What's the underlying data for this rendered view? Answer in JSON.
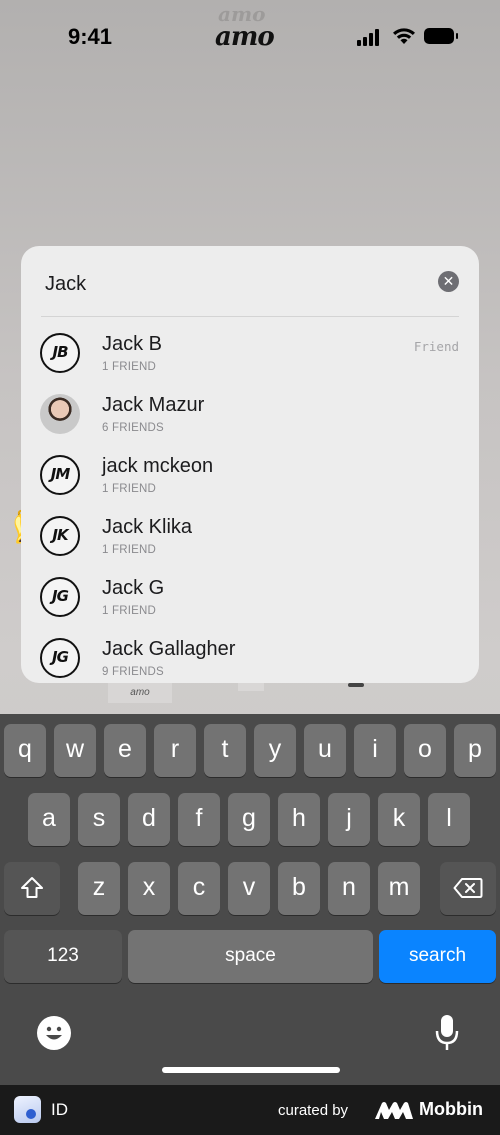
{
  "status_bar": {
    "time": "9:41",
    "logo": "amo"
  },
  "search": {
    "query": "Jack",
    "clear_icon": "clear-circle-icon"
  },
  "results": [
    {
      "initials": "JB",
      "name": "Jack B",
      "count": "1 FRIEND",
      "tag": "Friend",
      "avatar": "initials"
    },
    {
      "initials": "",
      "name": "Jack Mazur",
      "count": "6 FRIENDS",
      "tag": "",
      "avatar": "photo"
    },
    {
      "initials": "JM",
      "name": "jack mckeon",
      "count": "1 FRIEND",
      "tag": "",
      "avatar": "initials"
    },
    {
      "initials": "JK",
      "name": "Jack Klika",
      "count": "1 FRIEND",
      "tag": "",
      "avatar": "initials"
    },
    {
      "initials": "JG",
      "name": "Jack G",
      "count": "1 FRIEND",
      "tag": "",
      "avatar": "initials"
    },
    {
      "initials": "JG",
      "name": "Jack Gallagher",
      "count": "9 FRIENDS",
      "tag": "",
      "avatar": "initials"
    }
  ],
  "background": {
    "thumb_logo": "amo"
  },
  "keyboard": {
    "row1": [
      "q",
      "w",
      "e",
      "r",
      "t",
      "y",
      "u",
      "i",
      "o",
      "p"
    ],
    "row2": [
      "a",
      "s",
      "d",
      "f",
      "g",
      "h",
      "j",
      "k",
      "l"
    ],
    "row3": [
      "z",
      "x",
      "c",
      "v",
      "b",
      "n",
      "m"
    ],
    "numbers_label": "123",
    "space_label": "space",
    "action_label": "search",
    "action_color": "#0a84ff"
  },
  "footer": {
    "id_label": "ID",
    "curated_by": "curated by",
    "brand": "Mobbin"
  }
}
